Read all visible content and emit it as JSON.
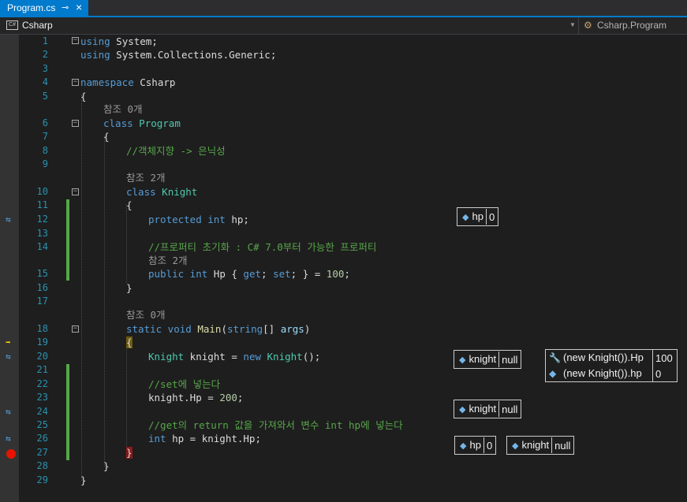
{
  "tab": {
    "title": "Program.cs",
    "pin_icon": "pin-icon",
    "close_icon": "close-icon"
  },
  "navbar": {
    "project": "Csharp",
    "class": "Csharp.Program",
    "project_badge": "C#"
  },
  "colors": {
    "accent": "#007acc",
    "line_number": "#2b91af",
    "keyword": "#569cd6",
    "type": "#4ec9b0",
    "comment": "#57a64a",
    "breakpoint": "#e51400"
  },
  "lines": [
    {
      "n": "1"
    },
    {
      "n": "2"
    },
    {
      "n": "3"
    },
    {
      "n": "4"
    },
    {
      "n": "5"
    },
    {
      "n": "6"
    },
    {
      "n": "7"
    },
    {
      "n": "8"
    },
    {
      "n": "9"
    },
    {
      "n": "10"
    },
    {
      "n": "11"
    },
    {
      "n": "12"
    },
    {
      "n": "13"
    },
    {
      "n": "14"
    },
    {
      "n": "15"
    },
    {
      "n": "16"
    },
    {
      "n": "17"
    },
    {
      "n": "18"
    },
    {
      "n": "19"
    },
    {
      "n": "20"
    },
    {
      "n": "21"
    },
    {
      "n": "22"
    },
    {
      "n": "23"
    },
    {
      "n": "24"
    },
    {
      "n": "25"
    },
    {
      "n": "26"
    },
    {
      "n": "27"
    },
    {
      "n": "28"
    },
    {
      "n": "29"
    }
  ],
  "code": {
    "l1_kw": "using",
    "l1_rest": " System;",
    "l2_kw": "using",
    "l2_rest": " System.Collections.Generic;",
    "l4_kw": "namespace",
    "l4_rest": " Csharp",
    "l5": "{",
    "ref0_a": "참조 0개",
    "l6_kw": "class",
    "l6_type": " Program",
    "l7": "{",
    "l8": "//객체지향 -> 은닉성",
    "ref2_a": "참조 2개",
    "l10_kw": "class",
    "l10_type": " Knight",
    "l11": "{",
    "l12_kw": "protected int",
    "l12_rest": " hp;",
    "l14": "//프로퍼티 초기화 : C# 7.0부터 가능한 프로퍼티",
    "ref2_b": "참조 2개",
    "l15_kw": "public int",
    "l15_a": " Hp { ",
    "l15_get": "get",
    "l15_b": "; ",
    "l15_set": "set",
    "l15_c": "; } = ",
    "l15_num": "100",
    "l15_d": ";",
    "l16": "}",
    "ref0_b": "참조 0개",
    "l18_kw": "static void",
    "l18_method": " Main",
    "l18_a": "(",
    "l18_kw2": "string",
    "l18_b": "[] ",
    "l18_param": "args",
    "l18_c": ")",
    "l19": "{",
    "l20_type": "Knight",
    "l20_a": " knight = ",
    "l20_kw": "new",
    "l20_b": " ",
    "l20_type2": "Knight",
    "l20_c": "();",
    "l22": "//set에 넣는다",
    "l23_a": "knight.Hp = ",
    "l23_num": "200",
    "l23_b": ";",
    "l25": "//get의 return 값을 가져와서 변수 int hp에 넣는다",
    "l26_kw": "int",
    "l26_a": " hp = knight.Hp;",
    "l27": "}",
    "l28": "}",
    "l29": "}"
  },
  "datatips": {
    "hp1": {
      "name": "hp",
      "value": "0"
    },
    "knight1": {
      "name": "knight",
      "value": "null"
    },
    "knight2": {
      "name": "knight",
      "value": "null"
    },
    "hp2": {
      "name": "hp",
      "value": "0"
    },
    "knight3": {
      "name": "knight",
      "value": "null"
    },
    "expr": [
      {
        "name": "(new Knight()).Hp",
        "value": "100",
        "icon": "wrench-icon"
      },
      {
        "name": "(new Knight()).hp",
        "value": "0",
        "icon": "field-icon"
      }
    ]
  },
  "glyph_icons": {
    "bookmark": "pinned-datatip-icon",
    "exec": "current-statement-arrow-icon",
    "breakpoint": "breakpoint-icon"
  }
}
